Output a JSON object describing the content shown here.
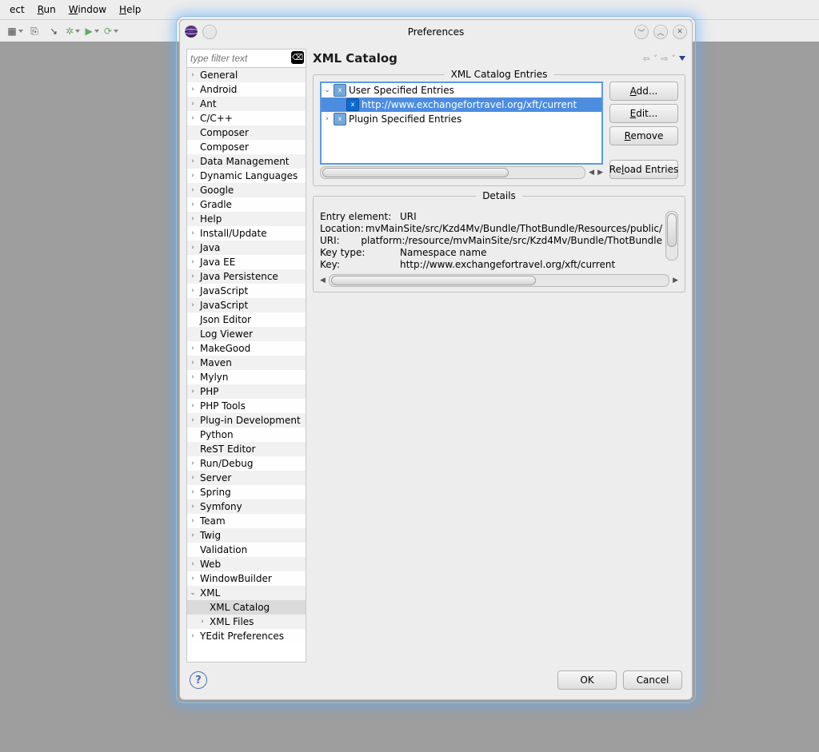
{
  "menubar": {
    "items": [
      "ect",
      "Run",
      "Window",
      "Help"
    ],
    "underline": [
      null,
      "R",
      "W",
      "H"
    ]
  },
  "dialog": {
    "title": "Preferences"
  },
  "filter": {
    "placeholder": "type filter text"
  },
  "nav": [
    {
      "label": "General",
      "depth": 1,
      "arrow": ">"
    },
    {
      "label": "Android",
      "depth": 1,
      "arrow": ">"
    },
    {
      "label": "Ant",
      "depth": 1,
      "arrow": ">"
    },
    {
      "label": "C/C++",
      "depth": 1,
      "arrow": ">"
    },
    {
      "label": "Composer",
      "depth": 1,
      "arrow": ""
    },
    {
      "label": "Composer",
      "depth": 1,
      "arrow": ""
    },
    {
      "label": "Data Management",
      "depth": 1,
      "arrow": ">"
    },
    {
      "label": "Dynamic Languages",
      "depth": 1,
      "arrow": ">"
    },
    {
      "label": "Google",
      "depth": 1,
      "arrow": ">"
    },
    {
      "label": "Gradle",
      "depth": 1,
      "arrow": ">"
    },
    {
      "label": "Help",
      "depth": 1,
      "arrow": ">"
    },
    {
      "label": "Install/Update",
      "depth": 1,
      "arrow": ">"
    },
    {
      "label": "Java",
      "depth": 1,
      "arrow": ">"
    },
    {
      "label": "Java EE",
      "depth": 1,
      "arrow": ">"
    },
    {
      "label": "Java Persistence",
      "depth": 1,
      "arrow": ">"
    },
    {
      "label": "JavaScript",
      "depth": 1,
      "arrow": ">"
    },
    {
      "label": "JavaScript",
      "depth": 1,
      "arrow": ">"
    },
    {
      "label": "Json Editor",
      "depth": 1,
      "arrow": ""
    },
    {
      "label": "Log Viewer",
      "depth": 1,
      "arrow": ""
    },
    {
      "label": "MakeGood",
      "depth": 1,
      "arrow": ">"
    },
    {
      "label": "Maven",
      "depth": 1,
      "arrow": ">"
    },
    {
      "label": "Mylyn",
      "depth": 1,
      "arrow": ">"
    },
    {
      "label": "PHP",
      "depth": 1,
      "arrow": ">"
    },
    {
      "label": "PHP Tools",
      "depth": 1,
      "arrow": ">"
    },
    {
      "label": "Plug-in Development",
      "depth": 1,
      "arrow": ">"
    },
    {
      "label": "Python",
      "depth": 1,
      "arrow": ""
    },
    {
      "label": "ReST Editor",
      "depth": 1,
      "arrow": ""
    },
    {
      "label": "Run/Debug",
      "depth": 1,
      "arrow": ">"
    },
    {
      "label": "Server",
      "depth": 1,
      "arrow": ">"
    },
    {
      "label": "Spring",
      "depth": 1,
      "arrow": ">"
    },
    {
      "label": "Symfony",
      "depth": 1,
      "arrow": ">"
    },
    {
      "label": "Team",
      "depth": 1,
      "arrow": ">"
    },
    {
      "label": "Twig",
      "depth": 1,
      "arrow": ">"
    },
    {
      "label": "Validation",
      "depth": 1,
      "arrow": ""
    },
    {
      "label": "Web",
      "depth": 1,
      "arrow": ">"
    },
    {
      "label": "WindowBuilder",
      "depth": 1,
      "arrow": ">"
    },
    {
      "label": "XML",
      "depth": 1,
      "arrow": "v",
      "expanded": true
    },
    {
      "label": "XML Catalog",
      "depth": 2,
      "arrow": "",
      "selected": true
    },
    {
      "label": "XML Files",
      "depth": 2,
      "arrow": ">"
    },
    {
      "label": "YEdit Preferences",
      "depth": 1,
      "arrow": ">"
    }
  ],
  "page": {
    "title": "XML Catalog"
  },
  "entries": {
    "caption": "XML Catalog Entries",
    "tree": [
      {
        "label": "User Specified Entries",
        "level": 0,
        "arrow": "v"
      },
      {
        "label": "http://www.exchangefortravel.org/xft/current",
        "level": 1,
        "arrow": "",
        "selected": true
      },
      {
        "label": "Plugin Specified Entries",
        "level": 0,
        "arrow": ">"
      }
    ],
    "buttons": {
      "add": "Add...",
      "edit": "Edit...",
      "remove": "Remove",
      "reload": "Reload Entries"
    },
    "underline": {
      "add": "A",
      "edit": "E",
      "remove": "R",
      "reload": "l"
    }
  },
  "details": {
    "caption": "Details",
    "rows": [
      {
        "k": "Entry element:",
        "v": "URI"
      },
      {
        "k": "Location:",
        "v": "mvMainSite/src/Kzd4Mv/Bundle/ThotBundle/Resources/public/"
      },
      {
        "k": "URI:",
        "v": "platform:/resource/mvMainSite/src/Kzd4Mv/Bundle/ThotBundle"
      },
      {
        "k": "Key type:",
        "v": "Namespace name"
      },
      {
        "k": "Key:",
        "v": "http://www.exchangefortravel.org/xft/current"
      }
    ]
  },
  "footer": {
    "ok": "OK",
    "cancel": "Cancel"
  }
}
